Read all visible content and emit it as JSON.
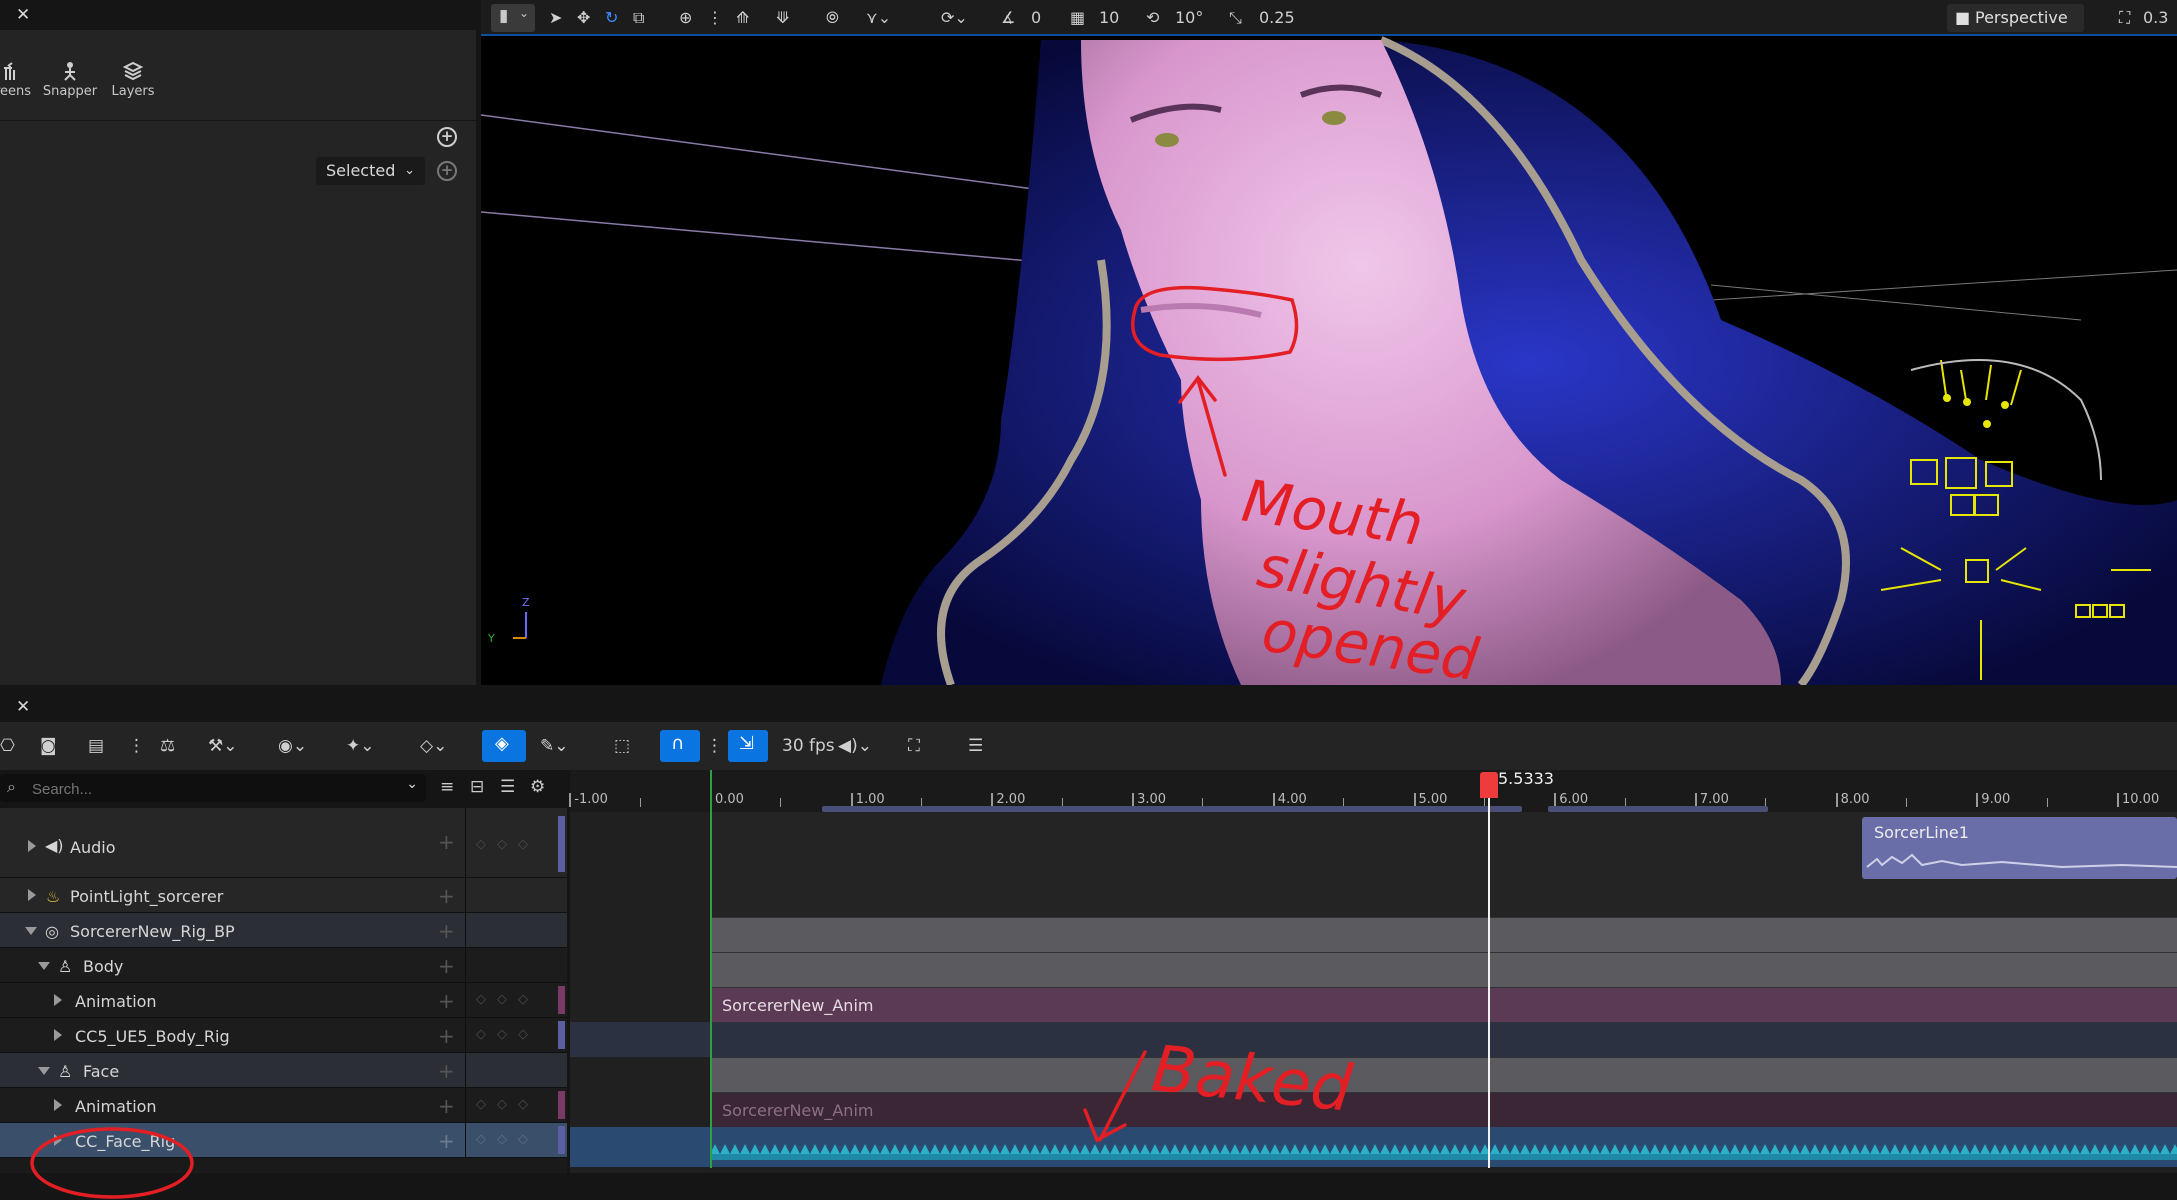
{
  "left_panel": {
    "tools": [
      {
        "label": "reens",
        "icon": "foliage-icon"
      },
      {
        "label": "Snapper",
        "icon": "snapper-icon"
      },
      {
        "label": "Layers",
        "icon": "layers-icon"
      }
    ],
    "filter_dropdown": "Selected"
  },
  "viewport": {
    "toolbar": {
      "rotation_snap": "0",
      "grid_snap": "10",
      "angle_snap": "10°",
      "scale_snap": "0.25",
      "view_mode": "Perspective",
      "camera_speed": "0.3"
    },
    "gizmo_labels": {
      "z": "Z",
      "y": "Y"
    },
    "annotation": "Mouth slightly opened"
  },
  "sequencer": {
    "fps": "30 fps",
    "search_placeholder": "Search...",
    "current_time": "5.5333",
    "ruler_ticks": [
      "-1.00",
      "0.00",
      "1.00",
      "2.00",
      "3.00",
      "4.00",
      "5.00",
      "6.00",
      "7.00",
      "8.00",
      "9.00",
      "10.00"
    ],
    "tracks": [
      {
        "label": "Audio",
        "icon": "speaker-icon",
        "indent": 0
      },
      {
        "label": "PointLight_sorcerer",
        "icon": "light-bulb-icon",
        "indent": 0
      },
      {
        "label": "SorcererNew_Rig_BP",
        "icon": "actor-icon",
        "indent": 0
      },
      {
        "label": "Body",
        "icon": "skeleton-icon",
        "indent": 1
      },
      {
        "label": "Animation",
        "icon": "",
        "indent": 2
      },
      {
        "label": "CC5_UE5_Body_Rig",
        "icon": "",
        "indent": 2
      },
      {
        "label": "Face",
        "icon": "skeleton-icon",
        "indent": 1
      },
      {
        "label": "Animation",
        "icon": "",
        "indent": 2
      },
      {
        "label": "CC_Face_Rig",
        "icon": "",
        "indent": 2
      }
    ],
    "sections": {
      "audio_clip": "SorcerLine1",
      "body_anim": "SorcererNew_Anim",
      "face_anim": "SorcererNew_Anim"
    },
    "annotation": "Baked"
  }
}
